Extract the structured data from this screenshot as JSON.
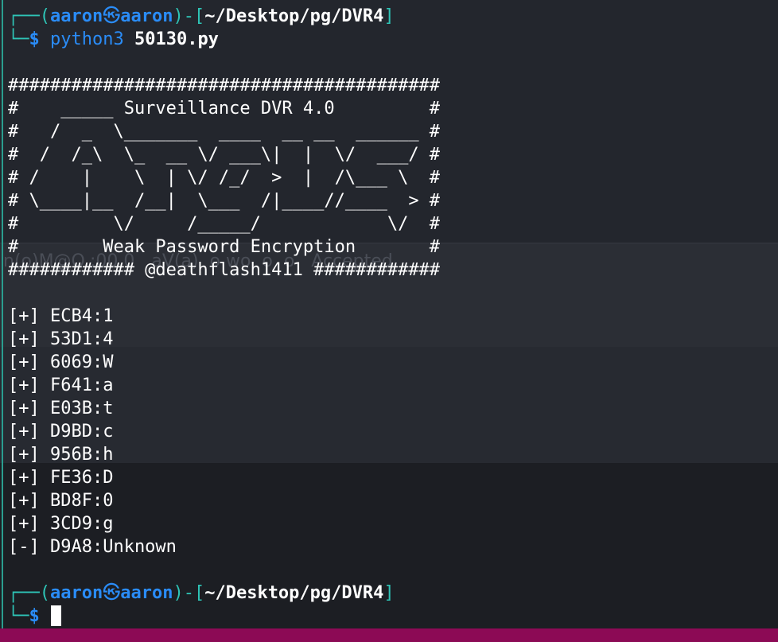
{
  "background": {
    "ghost_text": "n(o)M@O.:00.0   aV(a)  o wo  o  o   Accepted."
  },
  "prompt1": {
    "user": "aaron",
    "host": "aaron",
    "at_symbol": "㉿",
    "path": "~/Desktop/pg/DVR4",
    "dollar": "$",
    "command": "python3",
    "argument": "50130.py"
  },
  "banner": [
    "#########################################",
    "#    _____ Surveillance DVR 4.0         #",
    "#   /  _  \\_______  ____  __ __  ______ #",
    "#  /  /_\\  \\_  __ \\/ ___\\|  |  \\/  ___/ #",
    "# /    |    \\  | \\/ /_/  >  |  /\\___ \\  #",
    "# \\____|__  /__|  \\___  /|____//____  > #",
    "#         \\/     /_____/            \\/  #",
    "#        Weak Password Encryption       #",
    "############ @deathflash1411 ############"
  ],
  "results": [
    "[+] ECB4:1",
    "[+] 53D1:4",
    "[+] 6069:W",
    "[+] F641:a",
    "[+] E03B:t",
    "[+] D9BD:c",
    "[+] 956B:h",
    "[+] FE36:D",
    "[+] BD8F:0",
    "[+] 3CD9:g",
    "[-] D9A8:Unknown"
  ],
  "prompt2": {
    "user": "aaron",
    "host": "aaron",
    "at_symbol": "㉿",
    "path": "~/Desktop/pg/DVR4",
    "dollar": "$"
  },
  "colors": {
    "frame": "#2ec4b6",
    "user": "#2a8cf7",
    "text": "#ffffff",
    "taskbar": "#8c0a55"
  }
}
